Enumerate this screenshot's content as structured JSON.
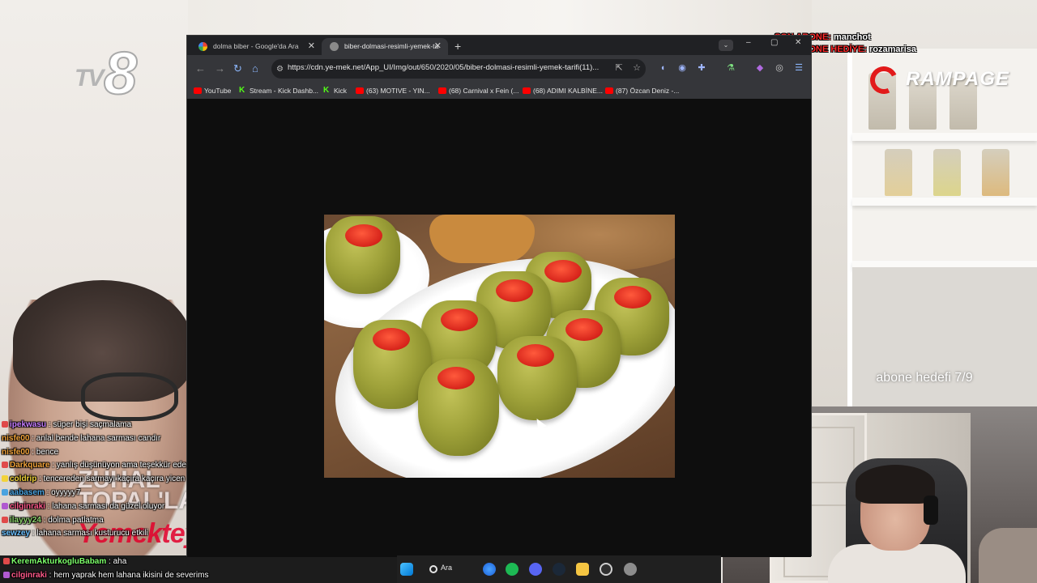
{
  "browser": {
    "tabs": [
      {
        "label": "dolma biber - Google'da Ara",
        "active": false
      },
      {
        "label": "biber-dolmasi-resimli-yemek-ta",
        "active": true
      }
    ],
    "url": "https://cdn.ye-mek.net/App_UI/Img/out/650/2020/05/biber-dolmasi-resimli-yemek-tarifi(11)...",
    "bookmarks": [
      {
        "label": "YouTube",
        "icon": "youtube-icon"
      },
      {
        "label": "Stream - Kick Dashb...",
        "icon": "kick-icon"
      },
      {
        "label": "Kick",
        "icon": "kick-icon"
      },
      {
        "label": "(63) MOTIVE - YIN...",
        "icon": "youtube-icon"
      },
      {
        "label": "(68) Carnival x Fein (...",
        "icon": "youtube-icon"
      },
      {
        "label": "(68) ADIMI KALBİNE...",
        "icon": "youtube-icon"
      },
      {
        "label": "(87) Özcan Deniz -...",
        "icon": "youtube-icon"
      }
    ]
  },
  "overlay": {
    "logo_left": {
      "tv": "TV",
      "eight": "8"
    },
    "alerts": [
      {
        "label": "SON ABONE:",
        "value": "manchot"
      },
      {
        "label": "SON ABONE HEDİYE:",
        "value": "rozamarisa"
      }
    ],
    "brand": "RAMPAGE",
    "goal": "abone hedefi 7/9",
    "show_title": {
      "line1": "ZUHAL",
      "line2": "TOPAL'LA",
      "line3": "Yemekteyiz"
    }
  },
  "chat": [
    {
      "user": "ipekwasu",
      "msg": ": süper bişi saçmalama",
      "color": "#c77dff",
      "badge": "#e04a4a"
    },
    {
      "user": "nisfe00",
      "msg": ": anlal bende lahana sarması candır",
      "color": "#f2a33a",
      "badge": ""
    },
    {
      "user": "nisfe00",
      "msg": ": bence",
      "color": "#f2a33a",
      "badge": ""
    },
    {
      "user": "Darkquare",
      "msg": ": yanlış düşünüyon ama teşekkür ederim",
      "color": "#f2a33a",
      "badge": "#e04a4a"
    },
    {
      "user": "coldrip",
      "msg": ": tencereden sarmayı kaçıra kaçıra yicen abi ne lahanası",
      "color": "#f2d33a",
      "badge": "#f2d33a"
    },
    {
      "user": "aabasem",
      "msg": ": oyyyyy7",
      "color": "#4aa3e0",
      "badge": "#4aa3e0"
    },
    {
      "user": "cilginraki",
      "msg": ": lahana sarması da güzel oluyor",
      "color": "#ff5a8a",
      "badge": "#b05ad0"
    },
    {
      "user": "ilayyy24",
      "msg": ": dolma patlatma",
      "color": "#8ad06a",
      "badge": "#e04a4a"
    },
    {
      "user": "sewzey",
      "msg": ": lahana sarması kusturucu etkili",
      "color": "#6ac0ff",
      "badge": ""
    }
  ],
  "chat_bottom": [
    {
      "user": "KeremAkturkogluBabam",
      "msg": ": aha",
      "color": "#7cff6a",
      "badge": "#e04a4a"
    },
    {
      "user": "cilginraki",
      "msg": ": hem yaprak hem lahana ikisini de severims",
      "color": "#ff5a8a",
      "badge": "#b05ad0"
    }
  ],
  "taskbar": {
    "search_label": "Ara"
  },
  "colors": {
    "chrome_dark": "#202124",
    "chrome_toolbar": "#35363a",
    "alert_red": "#ff2a2a",
    "kick_green": "#53fc18"
  }
}
